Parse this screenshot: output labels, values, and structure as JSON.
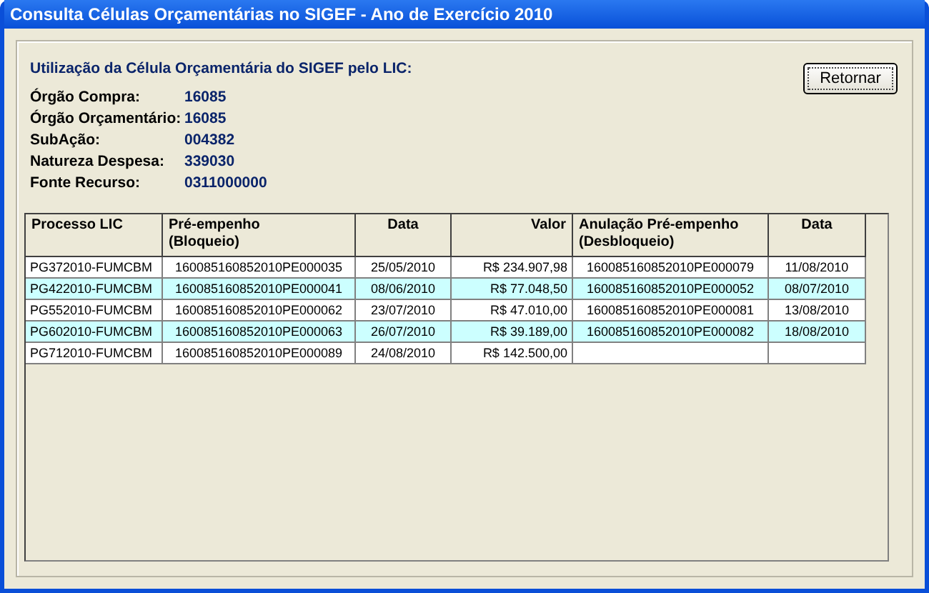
{
  "window": {
    "title": "Consulta Células Orçamentárias no SIGEF - Ano de Exercício 2010"
  },
  "heading": "Utilização da Célula Orçamentária do SIGEF pelo LIC:",
  "fields": [
    {
      "label": "Órgão Compra:",
      "value": "16085"
    },
    {
      "label": "Órgão Orçamentário:",
      "value": "16085"
    },
    {
      "label": "SubAção:",
      "value": "004382"
    },
    {
      "label": "Natureza Despesa:",
      "value": "339030"
    },
    {
      "label": "Fonte Recurso:",
      "value": "0311000000"
    }
  ],
  "buttons": [
    "Retornar"
  ],
  "table": {
    "columns": [
      "Processo LIC",
      "Pré-empenho\n(Bloqueio)",
      "Data",
      "Valor",
      "Anulação Pré-empenho\n(Desbloqueio)",
      "Data"
    ],
    "rows": [
      [
        "PG372010-FUMCBM",
        "160085160852010PE000035",
        "25/05/2010",
        "R$ 234.907,98",
        "160085160852010PE000079",
        "11/08/2010"
      ],
      [
        "PG422010-FUMCBM",
        "160085160852010PE000041",
        "08/06/2010",
        "R$ 77.048,50",
        "160085160852010PE000052",
        "08/07/2010"
      ],
      [
        "PG552010-FUMCBM",
        "160085160852010PE000062",
        "23/07/2010",
        "R$ 47.010,00",
        "160085160852010PE000081",
        "13/08/2010"
      ],
      [
        "PG602010-FUMCBM",
        "160085160852010PE000063",
        "26/07/2010",
        "R$ 39.189,00",
        "160085160852010PE000082",
        "18/08/2010"
      ],
      [
        "PG712010-FUMCBM",
        "160085160852010PE000089",
        "24/08/2010",
        "R$ 142.500,00",
        "",
        ""
      ]
    ]
  }
}
